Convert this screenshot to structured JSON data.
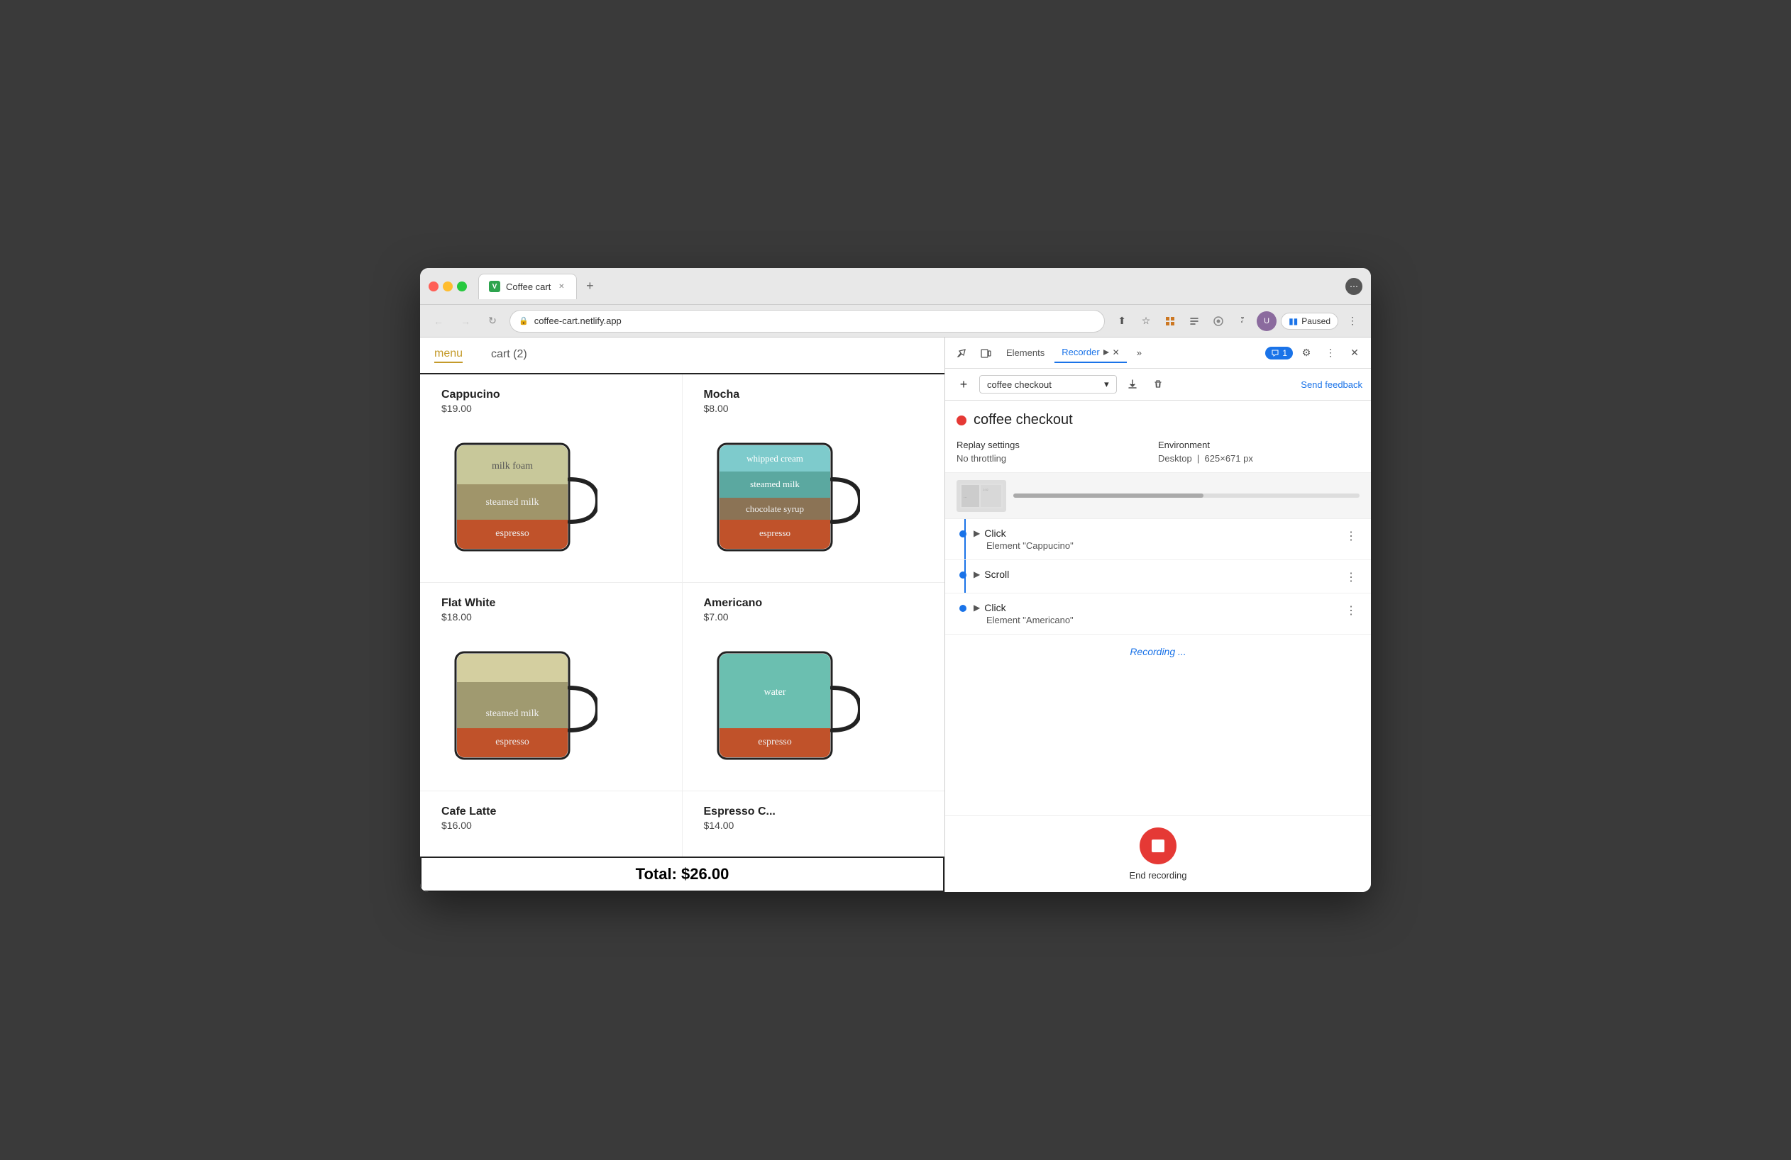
{
  "browser": {
    "tab_title": "Coffee cart",
    "tab_favicon_letter": "V",
    "url": "coffee-cart.netlify.app",
    "new_tab_symbol": "+",
    "paused_label": "Paused"
  },
  "coffee_app": {
    "nav": {
      "menu_label": "menu",
      "cart_label": "cart (2)"
    },
    "items": [
      {
        "name": "Cappucino",
        "price": "$19.00",
        "layers": [
          {
            "label": "milk foam",
            "color": "#c8c89a",
            "height": 35
          },
          {
            "label": "steamed milk",
            "color": "#a0956a",
            "height": 30
          },
          {
            "label": "espresso",
            "color": "#c0522a",
            "height": 35
          }
        ]
      },
      {
        "name": "Mocha",
        "price": "$8.00",
        "layers": [
          {
            "label": "whipped cream",
            "color": "#7ecbcc",
            "height": 25
          },
          {
            "label": "steamed milk",
            "color": "#5ba8a0",
            "height": 25
          },
          {
            "label": "chocolate syrup",
            "color": "#8b7355",
            "height": 25
          },
          {
            "label": "espresso",
            "color": "#c0522a",
            "height": 25
          }
        ]
      },
      {
        "name": "Flat White",
        "price": "$18.00",
        "layers": [
          {
            "label": "",
            "color": "#d4cfa0",
            "height": 30
          },
          {
            "label": "steamed milk",
            "color": "#a09a70",
            "height": 40
          },
          {
            "label": "espresso",
            "color": "#c0522a",
            "height": 35
          }
        ]
      },
      {
        "name": "Americano",
        "price": "$7.00",
        "layers": [
          {
            "label": "water",
            "color": "#6bbfb0",
            "height": 80
          },
          {
            "label": "espresso",
            "color": "#c0522a",
            "height": 40
          }
        ]
      },
      {
        "name": "Cafe Latte",
        "price": "$16.00",
        "layers": []
      },
      {
        "name": "Espresso C...",
        "price": "$14.00",
        "layers": []
      }
    ],
    "total_label": "Total: $26.00"
  },
  "devtools": {
    "tabs": [
      {
        "label": "Elements",
        "active": false
      },
      {
        "label": "Recorder",
        "active": true
      }
    ],
    "close_icon": "×",
    "more_tabs_icon": "»",
    "chat_badge": "1",
    "settings_icon": "⚙",
    "more_icon": "⋮",
    "close_panel_icon": "×",
    "recorder": {
      "add_icon": "+",
      "recording_name": "coffee checkout",
      "dropdown_icon": "▾",
      "export_icon": "↑",
      "delete_icon": "🗑",
      "send_feedback": "Send feedback",
      "title": "coffee checkout",
      "dot_color": "#e53935",
      "replay_settings": {
        "label": "Replay settings",
        "throttle_label": "No throttling",
        "environment_label": "Environment",
        "desktop_label": "Desktop",
        "resolution": "625×671 px"
      },
      "steps": [
        {
          "type": "Click",
          "element": "Element \"Cappucino\"",
          "has_arrow": true,
          "expanded": false
        },
        {
          "type": "Scroll",
          "element": "",
          "has_arrow": true,
          "expanded": false
        },
        {
          "type": "Click",
          "element": "Element \"Americano\"",
          "has_arrow": true,
          "expanded": false
        }
      ],
      "recording_status": "Recording ...",
      "end_recording_label": "End recording"
    }
  }
}
